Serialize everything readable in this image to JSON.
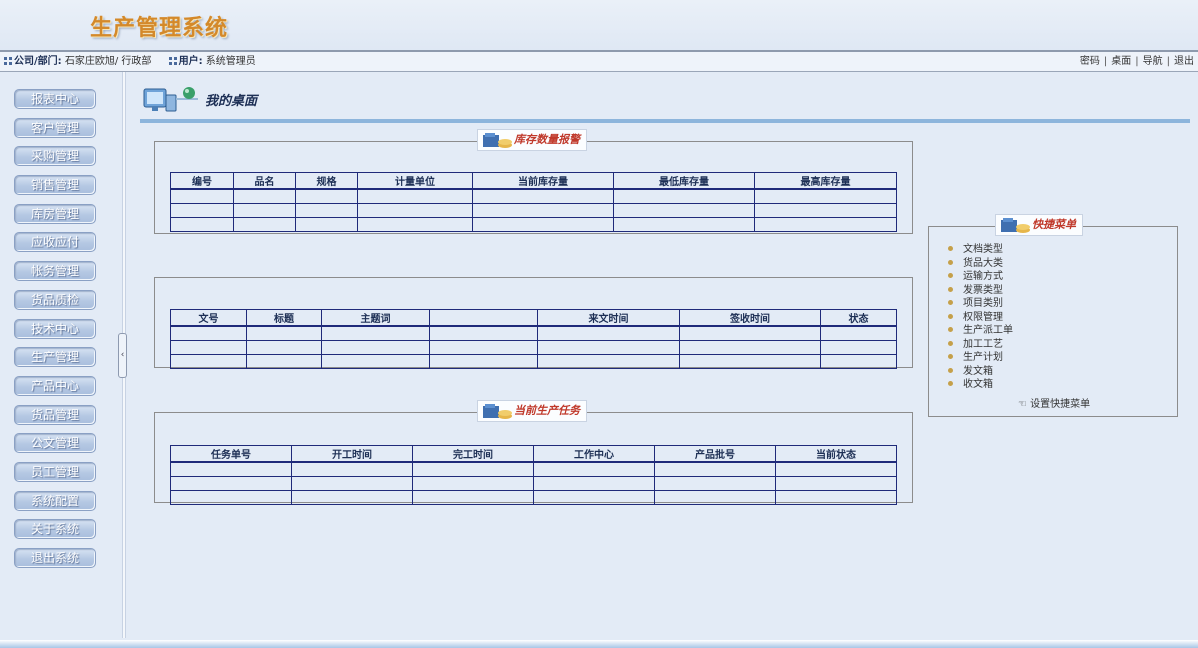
{
  "header": {
    "app_title": "生产管理系统"
  },
  "infobar": {
    "company_label": "公司/部门:",
    "company_value": "石家庄欧旭/ 行政部",
    "user_label": "用户:",
    "user_value": "系统管理员",
    "links": [
      "密码",
      "桌面",
      "导航",
      "退出"
    ]
  },
  "nav": {
    "items": [
      "报表中心",
      "客户管理",
      "采购管理",
      "销售管理",
      "库房管理",
      "应收应付",
      "帐务管理",
      "货品质检",
      "技术中心",
      "生产管理",
      "产品中心",
      "货品管理",
      "公文管理",
      "员工管理",
      "系统配置",
      "关于系统",
      "退出系统"
    ]
  },
  "desk": {
    "title": "我的桌面"
  },
  "stock_panel": {
    "badge": "库存数量报警",
    "columns": [
      "编号",
      "品名",
      "规格",
      "计量单位",
      "当前库存量",
      "最低库存量",
      "最高库存量"
    ]
  },
  "doc_panel": {
    "columns": [
      "文号",
      "标题",
      "主题词",
      "",
      "来文时间",
      "签收时间",
      "状态"
    ]
  },
  "task_panel": {
    "badge": "当前生产任务",
    "columns": [
      "任务单号",
      "开工时间",
      "完工时间",
      "工作中心",
      "产品批号",
      "当前状态"
    ]
  },
  "quick_menu": {
    "badge": "快捷菜单",
    "items": [
      "文档类型",
      "货品大类",
      "运输方式",
      "发票类型",
      "项目类别",
      "权限管理",
      "生产派工单",
      "加工工艺",
      "生产计划",
      "发文箱",
      "收文箱"
    ],
    "settings_label": "设置快捷菜单"
  }
}
